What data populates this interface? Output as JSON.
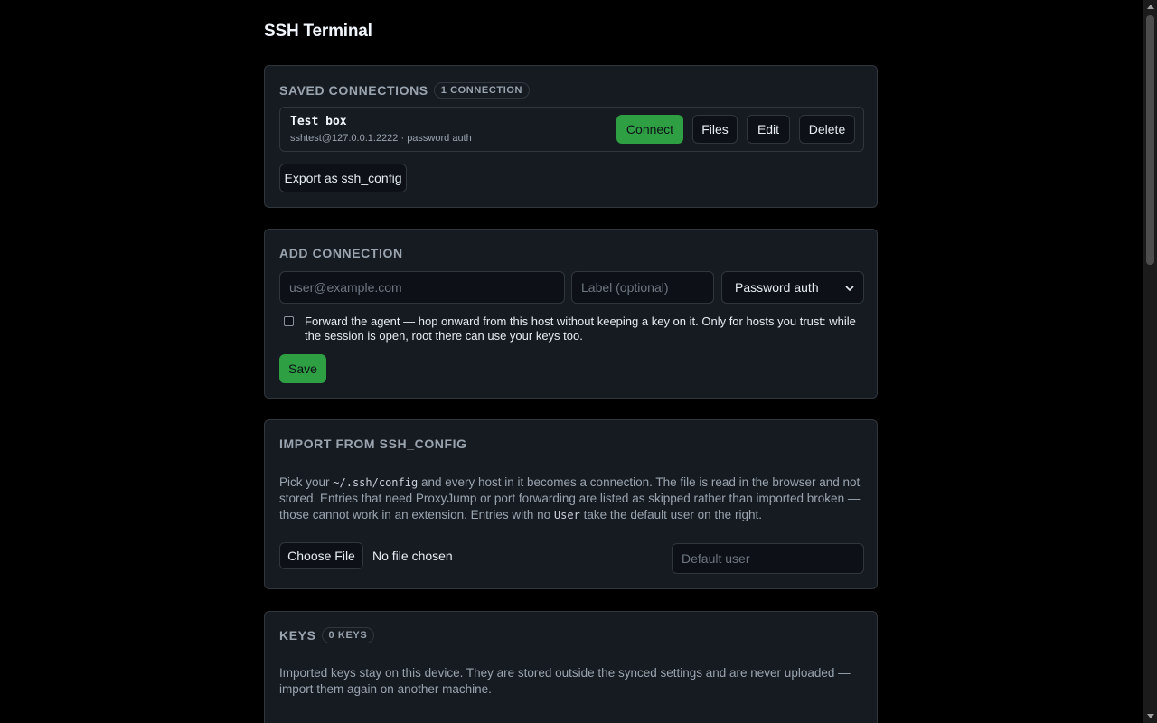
{
  "page": {
    "title": "SSH Terminal"
  },
  "saved": {
    "heading": "Saved connections",
    "count_badge": "1 connection",
    "connections": [
      {
        "name": "Test box",
        "detail": "sshtest@127.0.0.1:2222 · password auth",
        "connect_label": "Connect",
        "files_label": "Files",
        "edit_label": "Edit",
        "delete_label": "Delete"
      }
    ],
    "export_label": "Export as ssh_config"
  },
  "add": {
    "heading": "Add connection",
    "host_placeholder": "user@example.com",
    "label_placeholder": "Label (optional)",
    "auth_selected": "Password auth",
    "forward_agent_text": "Forward the agent — hop onward from this host without keeping a key on it. Only for hosts you trust: while the session is open, root there can use your keys too.",
    "forward_agent_checked": false,
    "save_label": "Save"
  },
  "import": {
    "heading": "Import from ssh_config",
    "desc_part1": "Pick your ",
    "desc_code1": "~/.ssh/config",
    "desc_part2": " and every host in it becomes a connection. The file is read in the browser and not stored. Entries that need ProxyJump or port forwarding are listed as skipped rather than imported broken — those cannot work in an extension. Entries with no ",
    "desc_code2": "User",
    "desc_part3": " take the default user on the right.",
    "choose_file_label": "Choose File",
    "no_file_text": "No file chosen",
    "default_user_placeholder": "Default user"
  },
  "keys": {
    "heading": "Keys",
    "count_badge": "0 keys",
    "description": "Imported keys stay on this device. They are stored outside the synced settings and are never uploaded — import them again on another machine."
  },
  "colors": {
    "accent_green": "#2ea043",
    "background": "#000000",
    "card": "#161b22"
  }
}
